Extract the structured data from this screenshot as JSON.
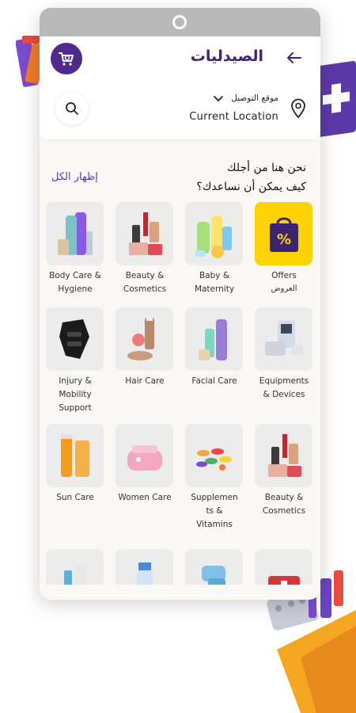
{
  "header": {
    "title": "الصيدليات",
    "location_label": "موقع التوصيل",
    "location_value": "Current Location"
  },
  "promo": {
    "line1": "نحن هنا من أجلك",
    "line2": "كيف يمكن أن نساعدك؟",
    "show_all": "إظهار الكل"
  },
  "colors": {
    "brand": "#4f2a8a",
    "title": "#3d2470",
    "offers_bg": "#ffd200"
  },
  "categories": [
    {
      "label": "Offers",
      "sub": "العروض",
      "icon": "offers-bag-icon"
    },
    {
      "label": "Baby & Maternity",
      "icon": "baby-products-icon"
    },
    {
      "label": "Beauty & Cosmetics",
      "icon": "cosmetics-icon"
    },
    {
      "label": "Body Care & Hygiene",
      "icon": "body-care-icon"
    },
    {
      "label": "Equipments & Devices",
      "icon": "blood-pressure-device-icon"
    },
    {
      "label": "Facial Care",
      "icon": "facial-care-icon"
    },
    {
      "label": "Hair Care",
      "icon": "hair-care-icon"
    },
    {
      "label": "Injury & Mobility Support",
      "icon": "support-brace-icon"
    },
    {
      "label": "Beauty & Cosmetics",
      "icon": "cosmetics-icon"
    },
    {
      "label": "Supplemen ts & Vitamins",
      "icon": "vitamins-pills-icon"
    },
    {
      "label": "Women Care",
      "icon": "women-care-icon"
    },
    {
      "label": "Sun Care",
      "icon": "sunscreen-icon"
    },
    {
      "label": "",
      "icon": "first-aid-kit-icon"
    },
    {
      "label": "",
      "icon": "gloves-icon"
    },
    {
      "label": "",
      "icon": "spray-bottle-icon"
    },
    {
      "label": "",
      "icon": "dental-care-icon"
    }
  ]
}
